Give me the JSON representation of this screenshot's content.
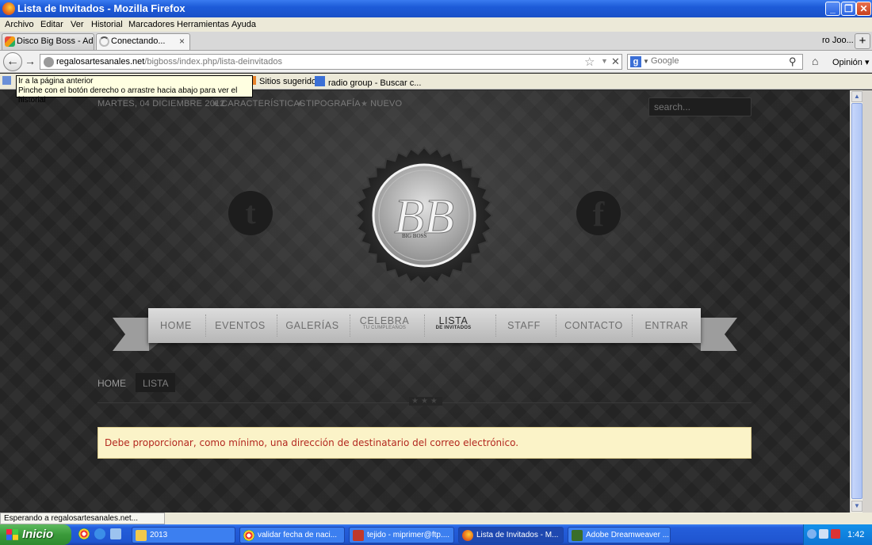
{
  "window": {
    "title": "Lista de Invitados - Mozilla Firefox"
  },
  "menu": [
    "Archivo",
    "Editar",
    "Ver",
    "Historial",
    "Marcadores",
    "Herramientas",
    "Ayuda"
  ],
  "tabs": [
    {
      "label": "Disco Big Boss - Admi..."
    },
    {
      "label": "Conectando...",
      "close": "×"
    }
  ],
  "tab_overflow": "ro Joo...",
  "new_tab": "+",
  "nav": {
    "url_domain": "regalosartesanales.net",
    "url_path": "/bigboss/index.php/lista-deinvitados",
    "search_placeholder": "Google",
    "search_engine_letter": "g",
    "opinion": "Opinión"
  },
  "bookmarks": [
    {
      "label": "Sitios sugeridos"
    },
    {
      "label": "radio group - Buscar c..."
    }
  ],
  "tooltip": {
    "line1": "Ir a la página anterior",
    "line2": "Pinche con el botón derecho o arrastre hacia abajo para ver el historial"
  },
  "site": {
    "date": "MARTES, 04 DICIEMBRE 2012",
    "top_links": [
      "CARACTERÍSTICAS",
      "TIPOGRAFÍA",
      "NUEVO"
    ],
    "search_placeholder": "search...",
    "social": {
      "twitter_glyph": "t",
      "facebook_glyph": "f"
    },
    "logo": {
      "monogram": "BB",
      "text": "BIG BOSS"
    },
    "menu": [
      {
        "label": "HOME",
        "sub": ""
      },
      {
        "label": "EVENTOS",
        "sub": ""
      },
      {
        "label": "GALERÍAS",
        "sub": ""
      },
      {
        "label": "CELEBRA",
        "sub": "TU CUMPLEAÑOS"
      },
      {
        "label": "LISTA",
        "sub": "DE INVITADOS"
      },
      {
        "label": "STAFF",
        "sub": ""
      },
      {
        "label": "CONTACTO",
        "sub": ""
      },
      {
        "label": "ENTRAR",
        "sub": ""
      }
    ],
    "breadcrumb": {
      "home": "HOME",
      "current": "LISTA"
    },
    "divider_stars": "★★★",
    "alert": "Debe proporcionar, como mínimo, una dirección de destinatario del correo electrónico."
  },
  "status": "Esperando a regalosartesanales.net...",
  "taskbar": {
    "start": "Inicio",
    "tasks": [
      {
        "label": "2013",
        "color": "#f2c94c"
      },
      {
        "label": "validar fecha de naci...",
        "color": "#e8e8e8"
      },
      {
        "label": "tejido - miprimer@ftp....",
        "color": "#c0392b"
      },
      {
        "label": "Lista de Invitados - M...",
        "color": "#e2651c"
      },
      {
        "label": "Adobe Dreamweaver ...",
        "color": "#3a6e2a"
      }
    ],
    "clock": "1:42"
  },
  "colors": {
    "alert_text": "#b3281f",
    "alert_bg": "#fbf3c8",
    "xp_blue": "#245edb"
  }
}
